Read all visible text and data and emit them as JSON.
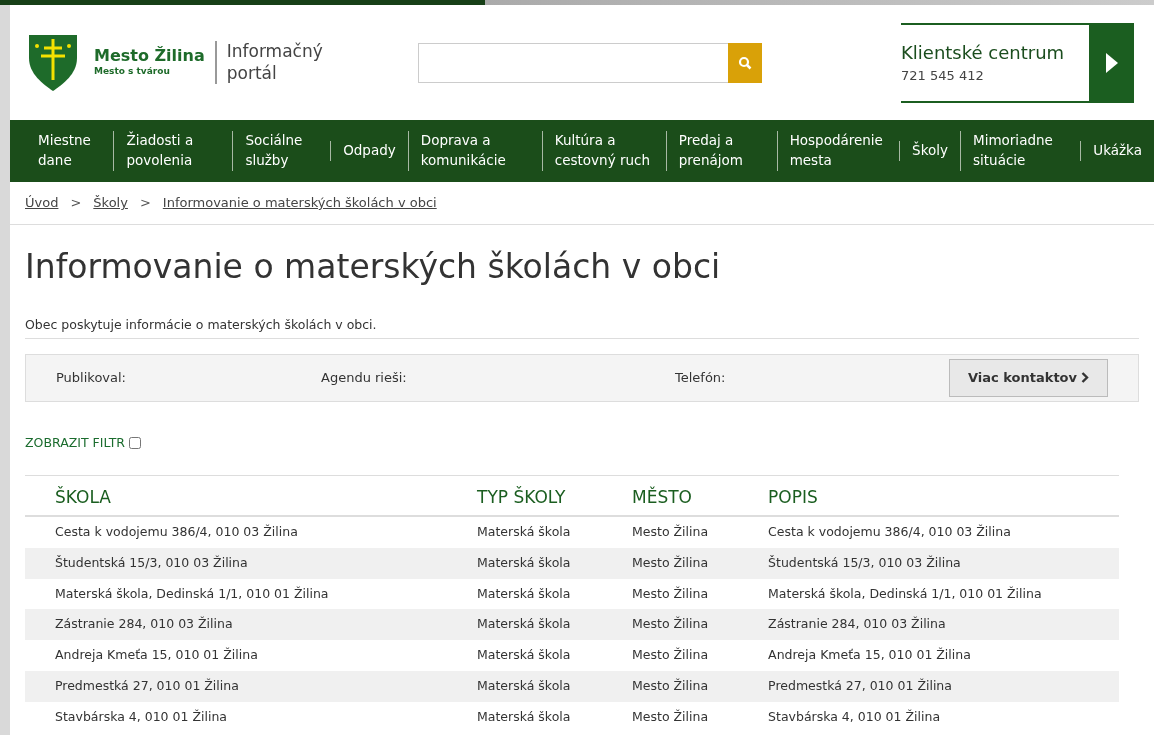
{
  "logo": {
    "name": "Mesto Žilina",
    "tagline": "Mesto s tvárou",
    "portal": "Informačný portál"
  },
  "client_center": {
    "title": "Klientské centrum",
    "phone": "721 545 412"
  },
  "nav": [
    {
      "label": "Miestne dane"
    },
    {
      "label": "Žiadosti a povolenia"
    },
    {
      "label": "Sociálne služby"
    },
    {
      "label": "Odpady"
    },
    {
      "label": "Doprava a komunikácie"
    },
    {
      "label": "Kultúra a cestovný ruch"
    },
    {
      "label": "Predaj a prenájom"
    },
    {
      "label": "Hospodárenie mesta"
    },
    {
      "label": "Školy"
    },
    {
      "label": "Mimoriadne situácie"
    },
    {
      "label": "Ukážka"
    }
  ],
  "breadcrumb": [
    {
      "label": "Úvod"
    },
    {
      "separator": ">",
      "label": "Školy"
    },
    {
      "separator": ">",
      "label": "Informovanie o materských školách v obci"
    }
  ],
  "page_title": "Informovanie o materských školách v obci",
  "description": "Obec poskytuje informácie o materských školách v obci.",
  "contact_bar": {
    "published": "Publikoval:",
    "agenda": "Agendu rieši:",
    "phone": "Telefón:",
    "button": "Viac kontaktov"
  },
  "filter": {
    "label": "ZOBRAZIT FILTR",
    "checked": false
  },
  "table": {
    "columns": [
      "ŠKOLA",
      "TYP ŠKOLY",
      "MĚSTO",
      "POPIS"
    ],
    "rows": [
      [
        "Cesta k vodojemu 386/4, 010 03 Žilina",
        "Materská škola",
        "Mesto Žilina",
        "Cesta k vodojemu 386/4, 010 03 Žilina"
      ],
      [
        "Študentská 15/3, 010 03 Žilina",
        "Materská škola",
        "Mesto Žilina",
        "Študentská 15/3, 010 03 Žilina"
      ],
      [
        "Materská škola, Dedinská 1/1, 010 01 Žilina",
        "Materská škola",
        "Mesto Žilina",
        "Materská škola, Dedinská 1/1, 010 01 Žilina"
      ],
      [
        "Zástranie 284, 010 03 Žilina",
        "Materská škola",
        "Mesto Žilina",
        "Zástranie 284, 010 03 Žilina"
      ],
      [
        "Andreja Kmeťa 15, 010 01 Žilina",
        "Materská škola",
        "Mesto Žilina",
        "Andreja Kmeťa 15, 010 01 Žilina"
      ],
      [
        "Predmestká 27, 010 01 Žilina",
        "Materská škola",
        "Mesto Žilina",
        "Predmestká 27, 010 01 Žilina"
      ],
      [
        "Stavbárska 4, 010 01 Žilina",
        "Materská škola",
        "Mesto Žilina",
        "Stavbárska 4, 010 01 Žilina"
      ]
    ]
  }
}
